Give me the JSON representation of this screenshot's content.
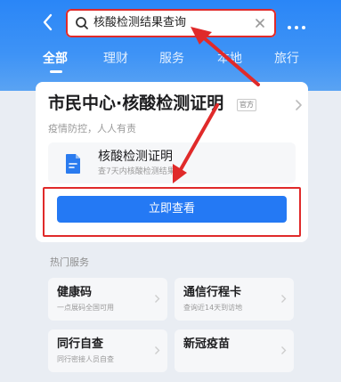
{
  "header": {
    "search": {
      "query": "核酸检测结果查询"
    },
    "tabs": [
      {
        "label": "全部",
        "active": true
      },
      {
        "label": "理财",
        "active": false
      },
      {
        "label": "服务",
        "active": false
      },
      {
        "label": "本地",
        "active": false
      },
      {
        "label": "旅行",
        "active": false
      }
    ]
  },
  "result_card": {
    "title": "市民中心·核酸检测证明",
    "badge": "官方",
    "subtitle": "疫情防控，人人有责",
    "service": {
      "title": "核酸检测证明",
      "description": "查7天内核酸检测结果"
    },
    "primary_button": "立即查看"
  },
  "hot_services": {
    "title": "热门服务",
    "items": [
      {
        "name": "健康码",
        "description": "一点展码全国可用"
      },
      {
        "name": "通信行程卡",
        "description": "查询近14天到访地"
      },
      {
        "name": "同行自查",
        "description": "同行密接人员自查"
      },
      {
        "name": "新冠疫苗",
        "description": ""
      }
    ]
  },
  "colors": {
    "header_blue": "#2a86f7",
    "button_blue": "#2479f4",
    "annotation_red": "#e02a2a"
  },
  "icons": [
    "back-arrow-icon",
    "search-icon",
    "clear-icon",
    "more-icon",
    "chevron-right-icon",
    "document-icon"
  ]
}
